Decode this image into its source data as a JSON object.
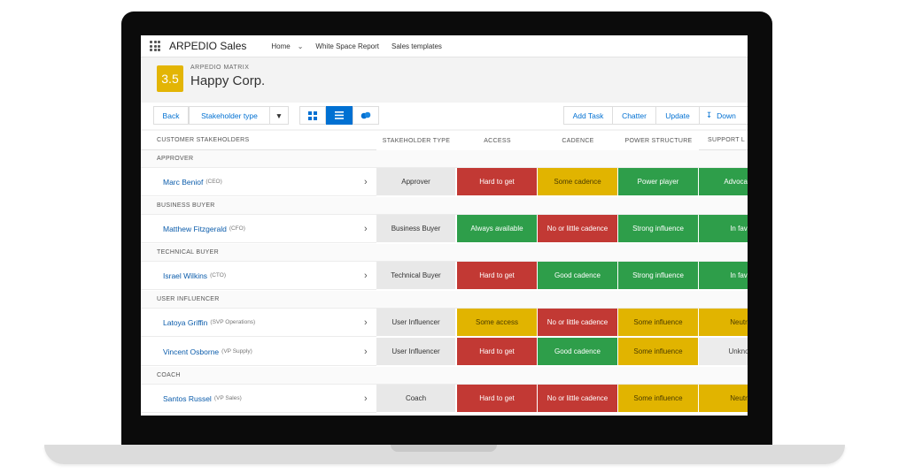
{
  "nav": {
    "app_name": "ARPEDIO Sales",
    "items": [
      "Home",
      "White Space Report",
      "Sales templates"
    ]
  },
  "header": {
    "badge": "3.5",
    "matrix_label": "ARPEDIO MATRIX",
    "company": "Happy Corp."
  },
  "toolbar": {
    "back": "Back",
    "stakeholder_type": "Stakeholder type",
    "add_task": "Add Task",
    "chatter": "Chatter",
    "update": "Update",
    "download": "Down"
  },
  "columns": [
    "CUSTOMER STAKEHOLDERS",
    "STAKEHOLDER TYPE",
    "ACCESS",
    "CADENCE",
    "POWER STRUCTURE",
    "SUPPORT L"
  ],
  "groups": [
    {
      "label": "APPROVER",
      "rows": [
        {
          "name": "Marc Beniof",
          "role": "(CEO)",
          "type": "Approver",
          "cells": [
            {
              "text": "Hard to get",
              "status": "red"
            },
            {
              "text": "Some cadence",
              "status": "yellow"
            },
            {
              "text": "Power player",
              "status": "green"
            },
            {
              "text": "Advocate",
              "status": "green"
            }
          ]
        }
      ]
    },
    {
      "label": "BUSINESS BUYER",
      "rows": [
        {
          "name": "Matthew Fitzgerald",
          "role": "(CFO)",
          "type": "Business Buyer",
          "cells": [
            {
              "text": "Always available",
              "status": "green"
            },
            {
              "text": "No or little cadence",
              "status": "red"
            },
            {
              "text": "Strong influence",
              "status": "green"
            },
            {
              "text": "In fav",
              "status": "green"
            }
          ]
        }
      ]
    },
    {
      "label": "TECHNICAL BUYER",
      "rows": [
        {
          "name": "Israel Wilkins",
          "role": "(CTO)",
          "type": "Technical Buyer",
          "cells": [
            {
              "text": "Hard to get",
              "status": "red"
            },
            {
              "text": "Good cadence",
              "status": "green"
            },
            {
              "text": "Strong influence",
              "status": "green"
            },
            {
              "text": "In fav",
              "status": "green"
            }
          ]
        }
      ]
    },
    {
      "label": "USER INFLUENCER",
      "rows": [
        {
          "name": "Latoya Griffin",
          "role": "(SVP Operations)",
          "type": "User Influencer",
          "cells": [
            {
              "text": "Some access",
              "status": "yellow"
            },
            {
              "text": "No or little cadence",
              "status": "red"
            },
            {
              "text": "Some influence",
              "status": "yellow"
            },
            {
              "text": "Neutr",
              "status": "yellow"
            }
          ]
        },
        {
          "name": "Vincent Osborne",
          "role": "(VP Supply)",
          "type": "User Influencer",
          "cells": [
            {
              "text": "Hard to get",
              "status": "red"
            },
            {
              "text": "Good cadence",
              "status": "green"
            },
            {
              "text": "Some influence",
              "status": "yellow"
            },
            {
              "text": "Unkno",
              "status": "grey"
            }
          ]
        }
      ]
    },
    {
      "label": "COACH",
      "rows": [
        {
          "name": "Santos Russel",
          "role": "(VP Sales)",
          "type": "Coach",
          "cells": [
            {
              "text": "Hard to get",
              "status": "red"
            },
            {
              "text": "No or little cadence",
              "status": "red"
            },
            {
              "text": "Some influence",
              "status": "yellow"
            },
            {
              "text": "Neutr",
              "status": "yellow"
            }
          ]
        }
      ]
    }
  ]
}
